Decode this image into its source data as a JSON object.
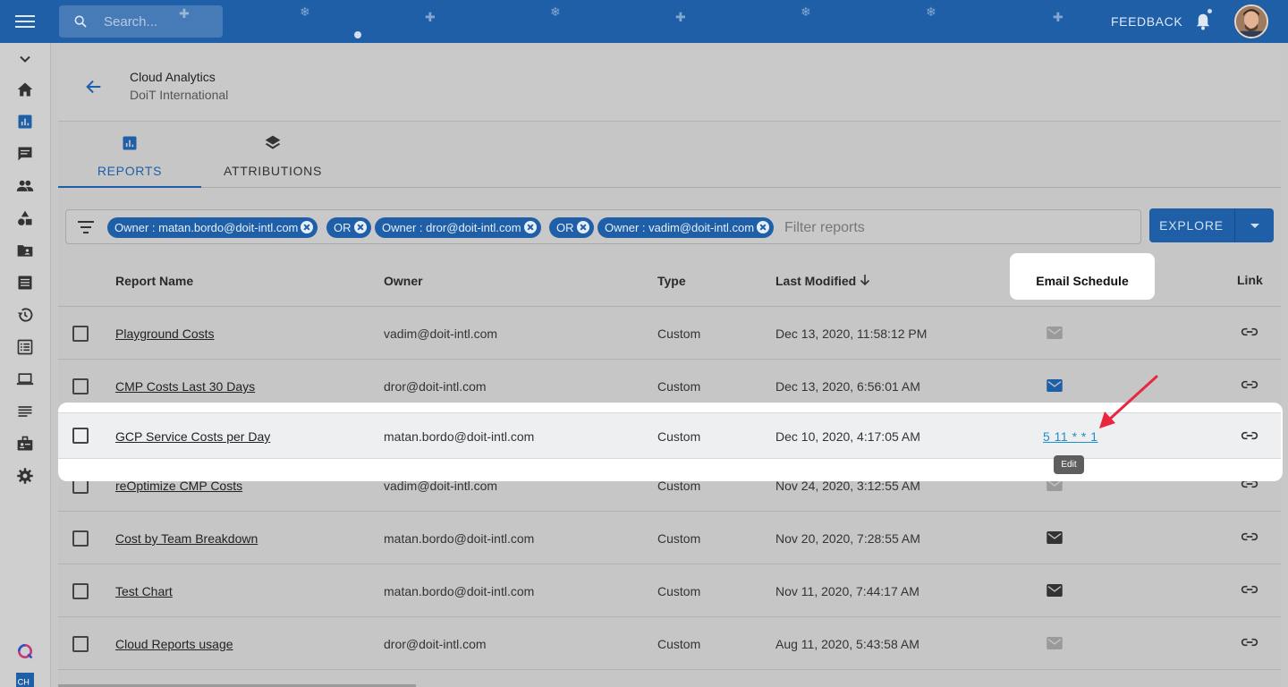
{
  "topbar": {
    "search_placeholder": "Search...",
    "feedback_label": "FEEDBACK",
    "brand_color": "#1f5fa8"
  },
  "sidebar": {
    "items": [
      {
        "icon": "chevron-down-icon"
      },
      {
        "icon": "home-icon"
      },
      {
        "icon": "analytics-icon",
        "active": true
      },
      {
        "icon": "chat-icon"
      },
      {
        "icon": "people-icon"
      },
      {
        "icon": "shapes-icon"
      },
      {
        "icon": "folder-account-icon"
      },
      {
        "icon": "notes-icon"
      },
      {
        "icon": "history-icon"
      },
      {
        "icon": "list-alt-icon"
      },
      {
        "icon": "laptop-icon"
      },
      {
        "icon": "subject-icon"
      },
      {
        "icon": "badge-icon"
      },
      {
        "icon": "settings-icon"
      }
    ]
  },
  "header": {
    "title": "Cloud Analytics",
    "subtitle": "DoiT International"
  },
  "tabs": [
    {
      "label": "REPORTS",
      "icon": "reports-icon",
      "active": true
    },
    {
      "label": "ATTRIBUTIONS",
      "icon": "layers-icon",
      "active": false
    }
  ],
  "filters": {
    "chips": [
      {
        "label": "Owner : matan.bordo@doit-intl.com"
      },
      {
        "label": "OR"
      },
      {
        "label": "Owner : dror@doit-intl.com"
      },
      {
        "label": "OR"
      },
      {
        "label": "Owner : vadim@doit-intl.com"
      }
    ],
    "placeholder": "Filter reports"
  },
  "explore_label": "EXPLORE",
  "table": {
    "columns": {
      "name": "Report Name",
      "owner": "Owner",
      "type": "Type",
      "modified": "Last Modified",
      "schedule": "Email Schedule",
      "link": "Link"
    },
    "rows": [
      {
        "name": "Playground Costs",
        "owner": "vadim@doit-intl.com",
        "type": "Custom",
        "modified": "Dec 13, 2020, 11:58:12 PM",
        "mail_state": "disabled"
      },
      {
        "name": "CMP Costs Last 30 Days",
        "owner": "dror@doit-intl.com",
        "type": "Custom",
        "modified": "Dec 13, 2020, 6:56:01 AM",
        "mail_state": "active"
      },
      {
        "name": "GCP Service Costs per Day",
        "owner": "matan.bordo@doit-intl.com",
        "type": "Custom",
        "modified": "Dec 10, 2020, 4:17:05 AM",
        "schedule": "5 11 * * 1",
        "tooltip": "Edit"
      },
      {
        "name": "reOptimize CMP Costs",
        "owner": "vadim@doit-intl.com",
        "type": "Custom",
        "modified": "Nov 24, 2020, 3:12:55 AM",
        "mail_state": "disabled"
      },
      {
        "name": "Cost by Team Breakdown",
        "owner": "matan.bordo@doit-intl.com",
        "type": "Custom",
        "modified": "Nov 20, 2020, 7:28:55 AM",
        "mail_state": "enabled"
      },
      {
        "name": "Test Chart",
        "owner": "matan.bordo@doit-intl.com",
        "type": "Custom",
        "modified": "Nov 11, 2020, 7:44:17 AM",
        "mail_state": "enabled"
      },
      {
        "name": "Cloud Reports usage",
        "owner": "dror@doit-intl.com",
        "type": "Custom",
        "modified": "Aug 11, 2020, 5:43:58 AM",
        "mail_state": "disabled"
      }
    ]
  }
}
